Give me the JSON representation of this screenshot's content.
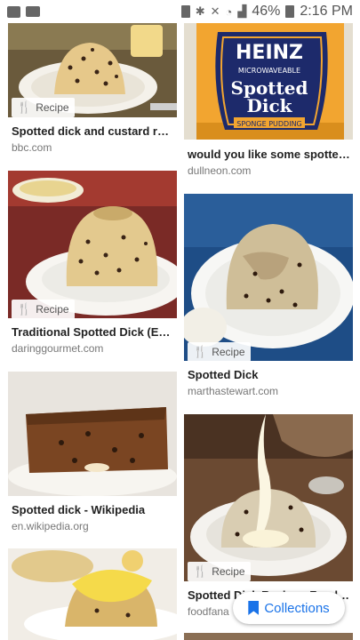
{
  "status_bar": {
    "battery": "46%",
    "time": "2:16 PM"
  },
  "results": {
    "left": [
      {
        "title": "Spotted dick and custard reci...",
        "source": "bbc.com",
        "badge": "Recipe"
      },
      {
        "title": "Traditional Spotted Dick (Eng...",
        "source": "daringgourmet.com",
        "badge": "Recipe"
      },
      {
        "title": "Spotted dick - Wikipedia",
        "source": "en.wikipedia.org"
      }
    ],
    "right": [
      {
        "title": "would you like some spotted ...",
        "source": "dullneon.com",
        "label_heinz": "HEINZ",
        "label_micro": "MICROWAVEABLE",
        "label_spotted": "Spotted",
        "label_dick": "Dick",
        "label_sponge": "SPONGE PUDDING"
      },
      {
        "title": "Spotted Dick",
        "source": "marthastewart.com",
        "badge": "Recipe"
      },
      {
        "title": "Spotted Dick Recipe - Food F...",
        "source": "foodfana",
        "badge": "Recipe"
      }
    ]
  },
  "collections_button": {
    "label": "Collections"
  }
}
